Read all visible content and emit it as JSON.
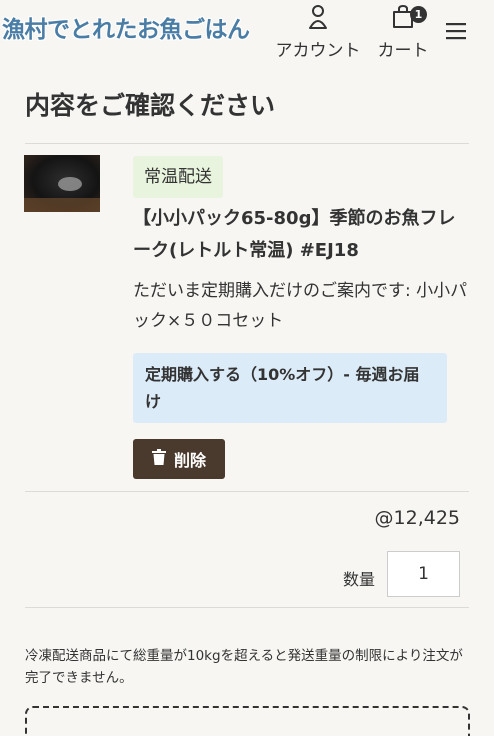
{
  "header": {
    "logo_text": "漁村でとれたお魚ごはん",
    "account_label": "アカウント",
    "cart_label": "カート",
    "cart_count": "1"
  },
  "page": {
    "title": "内容をご確認ください"
  },
  "item": {
    "tag": "常温配送",
    "name": "【小小パック65-80g】季節のお魚フレーク(レトルト常温) #EJ18",
    "note": "ただいま定期購入だけのご案内です: 小小パック×５０コセット",
    "subscription": "定期購入する（10%オフ）- 毎週お届け",
    "delete_label": "削除",
    "price": "@12,425",
    "quantity_label": "数量",
    "quantity_value": "1"
  },
  "notice": {
    "text": "冷凍配送商品にて総重量が10kgを超えると発送重量の制限により注文が完了できません。"
  }
}
